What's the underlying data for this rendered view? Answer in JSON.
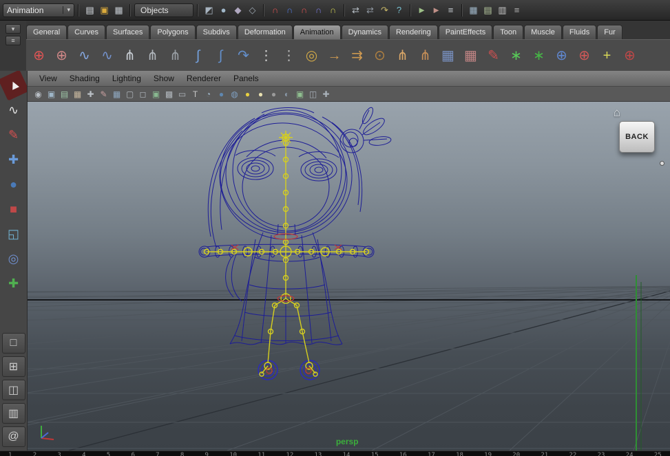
{
  "statusbar": {
    "mode": "Animation",
    "dropdown_arrow": "▾",
    "objects_label": "Objects",
    "file_icons": [
      {
        "name": "new-scene-icon",
        "glyph": "▤",
        "color": "#dde2e8"
      },
      {
        "name": "open-scene-icon",
        "glyph": "▣",
        "color": "#dcab3c"
      },
      {
        "name": "save-scene-icon",
        "glyph": "▦",
        "color": "#c4cad0"
      }
    ],
    "mask_icons": [
      {
        "name": "select-by-hierarchy-icon",
        "glyph": "◩",
        "color": "#a8b4c0"
      },
      {
        "name": "select-by-object-icon",
        "glyph": "●",
        "color": "#9fb6c8"
      },
      {
        "name": "select-by-component-icon",
        "glyph": "◆",
        "color": "#b0a8c0"
      },
      {
        "name": "selection-lock-icon",
        "glyph": "◇",
        "color": "#9aa4ae"
      }
    ],
    "snap_icons": [
      {
        "name": "snap-to-grid-icon",
        "glyph": "∩",
        "color": "#d85050"
      },
      {
        "name": "snap-to-curve-icon",
        "glyph": "∩",
        "color": "#5078d8"
      },
      {
        "name": "snap-to-point-icon",
        "glyph": "∩",
        "color": "#d85050"
      },
      {
        "name": "snap-to-plane-icon",
        "glyph": "∩",
        "color": "#7878d8"
      },
      {
        "name": "snap-to-view-icon",
        "glyph": "∩",
        "color": "#c8c850"
      }
    ],
    "history_icons": [
      {
        "name": "input-connections-icon",
        "glyph": "⇄",
        "color": "#b8c0c8"
      },
      {
        "name": "output-connections-icon",
        "glyph": "⇄",
        "color": "#8e96a0"
      },
      {
        "name": "construction-history-icon",
        "glyph": "↷",
        "color": "#c8b868"
      },
      {
        "name": "help-icon",
        "glyph": "?",
        "color": "#78c0d0"
      }
    ],
    "render_icons": [
      {
        "name": "render-current-frame-icon",
        "glyph": "►",
        "color": "#9ec088"
      },
      {
        "name": "ipr-render-icon",
        "glyph": "►",
        "color": "#c09088"
      },
      {
        "name": "render-settings-icon",
        "glyph": "≡",
        "color": "#c4cad0"
      }
    ],
    "panel_shortcut_icons": [
      {
        "name": "hypershade-panel-icon",
        "glyph": "▦",
        "color": "#9fb6c8"
      },
      {
        "name": "hypergraph-panel-icon",
        "glyph": "▤",
        "color": "#b6c89f"
      },
      {
        "name": "attribute-editor-icon",
        "glyph": "▥",
        "color": "#c8c8c8"
      },
      {
        "name": "tool-settings-icon",
        "glyph": "≡",
        "color": "#b0b0b0"
      }
    ]
  },
  "shelf": {
    "side_buttons": [
      {
        "name": "shelf-tabs-menu-icon",
        "glyph": "▾"
      },
      {
        "name": "shelf-menu-icon",
        "glyph": "≡"
      }
    ],
    "tabs": [
      {
        "name": "shelf-tab-general",
        "label": "General"
      },
      {
        "name": "shelf-tab-curves",
        "label": "Curves"
      },
      {
        "name": "shelf-tab-surfaces",
        "label": "Surfaces"
      },
      {
        "name": "shelf-tab-polygons",
        "label": "Polygons"
      },
      {
        "name": "shelf-tab-subdivs",
        "label": "Subdivs"
      },
      {
        "name": "shelf-tab-deformation",
        "label": "Deformation"
      },
      {
        "name": "shelf-tab-animation",
        "label": "Animation",
        "active": true
      },
      {
        "name": "shelf-tab-dynamics",
        "label": "Dynamics"
      },
      {
        "name": "shelf-tab-rendering",
        "label": "Rendering"
      },
      {
        "name": "shelf-tab-painteffects",
        "label": "PaintEffects"
      },
      {
        "name": "shelf-tab-toon",
        "label": "Toon"
      },
      {
        "name": "shelf-tab-muscle",
        "label": "Muscle"
      },
      {
        "name": "shelf-tab-fluids",
        "label": "Fluids"
      },
      {
        "name": "shelf-tab-fur",
        "label": "Fur"
      }
    ],
    "icons": [
      {
        "name": "set-key-icon",
        "glyph": "⊕",
        "color": "#e05555"
      },
      {
        "name": "set-breakdown-icon",
        "glyph": "⊕",
        "color": "#d08888"
      },
      {
        "name": "anim-curve-icon",
        "glyph": "∿",
        "color": "#86a8e0"
      },
      {
        "name": "anim-snapshot-icon",
        "glyph": "∿",
        "color": "#7492cc"
      },
      {
        "name": "skeleton-icon",
        "glyph": "⋔",
        "color": "#c8ced4"
      },
      {
        "name": "pose-icon",
        "glyph": "⋔",
        "color": "#b2b8be"
      },
      {
        "name": "walk-cycle-icon",
        "glyph": "⋔",
        "color": "#9aa0a6"
      },
      {
        "name": "joint-tool-icon",
        "glyph": "∫",
        "color": "#74a0dc"
      },
      {
        "name": "ik-handle-icon",
        "glyph": "∫",
        "color": "#6490cc"
      },
      {
        "name": "ik-spline-icon",
        "glyph": "↷",
        "color": "#6490cc"
      },
      {
        "name": "cluster-icon",
        "glyph": "⋮",
        "color": "#d0d0d0"
      },
      {
        "name": "lattice-points-icon",
        "glyph": "⋮",
        "color": "#b4b4b4"
      },
      {
        "name": "locator-icon",
        "glyph": "◎",
        "color": "#d0a848"
      },
      {
        "name": "point-constraint-icon",
        "glyph": "→",
        "color": "#cc9850"
      },
      {
        "name": "aim-constraint-icon",
        "glyph": "⇉",
        "color": "#cc9850"
      },
      {
        "name": "orient-constraint-icon",
        "glyph": "⊙",
        "color": "#b08040"
      },
      {
        "name": "character-set-icon",
        "glyph": "⋔",
        "color": "#dca868"
      },
      {
        "name": "subcharacter-icon",
        "glyph": "⋔",
        "color": "#c89058"
      },
      {
        "name": "anim-clip-icon",
        "glyph": "▦",
        "color": "#7890c0"
      },
      {
        "name": "anim-clip-2-icon",
        "glyph": "▦",
        "color": "#c08484"
      },
      {
        "name": "paint-skin-weights-icon",
        "glyph": "✎",
        "color": "#cc5050"
      },
      {
        "name": "motion-trail-icon",
        "glyph": "∗",
        "color": "#58c858"
      },
      {
        "name": "ghosting-icon",
        "glyph": "∗",
        "color": "#46b446"
      },
      {
        "name": "ik-fk-blend-icon",
        "glyph": "⊕",
        "color": "#6088d0"
      },
      {
        "name": "pole-vector-icon",
        "glyph": "⊕",
        "color": "#d05858"
      },
      {
        "name": "pin-joint-icon",
        "glyph": "+",
        "color": "#d8d858"
      },
      {
        "name": "rig-control-icon",
        "glyph": "⊕",
        "color": "#c04848"
      }
    ]
  },
  "toolbox": {
    "tools": [
      {
        "name": "select-tool",
        "glyph": "►",
        "color": "#f0f0f0",
        "bg": "#5f2020",
        "rot": -115
      },
      {
        "name": "lasso-tool",
        "glyph": "∿",
        "color": "#e0e0e0"
      },
      {
        "name": "paint-selection-tool",
        "glyph": "✎",
        "color": "#d85050"
      },
      {
        "name": "move-tool",
        "glyph": "✚",
        "color": "#6a9ad8"
      },
      {
        "name": "rotate-tool",
        "glyph": "●",
        "color": "#4a7ab8"
      },
      {
        "name": "scale-tool",
        "glyph": "■",
        "color": "#c04848"
      },
      {
        "name": "universal-manipulator-tool",
        "glyph": "◱",
        "color": "#70b0d0"
      },
      {
        "name": "soft-modification-tool",
        "glyph": "◎",
        "color": "#7090d0"
      },
      {
        "name": "show-manipulator-tool",
        "glyph": "✚",
        "color": "#50b050"
      }
    ],
    "layouts": [
      {
        "name": "layout-single-pane",
        "glyph": "□"
      },
      {
        "name": "layout-four-pane",
        "glyph": "⊞"
      },
      {
        "name": "layout-persp-outliner",
        "glyph": "◫"
      },
      {
        "name": "layout-persp-graph",
        "glyph": "▥"
      },
      {
        "name": "layout-hypergraph",
        "glyph": "@"
      }
    ]
  },
  "panel": {
    "menus": [
      {
        "name": "panel-menu-view",
        "label": "View"
      },
      {
        "name": "panel-menu-shading",
        "label": "Shading"
      },
      {
        "name": "panel-menu-lighting",
        "label": "Lighting"
      },
      {
        "name": "panel-menu-show",
        "label": "Show"
      },
      {
        "name": "panel-menu-renderer",
        "label": "Renderer"
      },
      {
        "name": "panel-menu-panels",
        "label": "Panels"
      }
    ],
    "toolbar_icons": [
      {
        "name": "select-camera-icon",
        "glyph": "◉",
        "color": "#b8bec4"
      },
      {
        "name": "camera-attributes-icon",
        "glyph": "▣",
        "color": "#9fb6c8"
      },
      {
        "name": "bookmarks-icon",
        "glyph": "▤",
        "color": "#9fc8a8"
      },
      {
        "name": "image-plane-icon",
        "glyph": "▦",
        "color": "#c8b89f"
      },
      {
        "name": "2d-pan-zoom-icon",
        "glyph": "✚",
        "color": "#b8bec4"
      },
      {
        "name": "grease-pencil-icon",
        "glyph": "✎",
        "color": "#c8a0a0"
      },
      {
        "name": "grid-toggle-icon",
        "glyph": "▦",
        "color": "#8fa8c0"
      },
      {
        "name": "film-gate-icon",
        "glyph": "▢",
        "color": "#b0b6bc"
      },
      {
        "name": "resolution-gate-icon",
        "glyph": "◻",
        "color": "#b0b6bc"
      },
      {
        "name": "gate-mask-icon",
        "glyph": "▣",
        "color": "#88b890"
      },
      {
        "name": "field-chart-icon",
        "glyph": "▩",
        "color": "#b0b6bc"
      },
      {
        "name": "safe-action-icon",
        "glyph": "▭",
        "color": "#b0b6bc"
      },
      {
        "name": "safe-title-icon",
        "glyph": "T",
        "color": "#c8c8c8"
      },
      {
        "name": "wireframe-mode-icon",
        "glyph": "◔",
        "color": "#9fb6c8"
      },
      {
        "name": "shaded-mode-icon",
        "glyph": "●",
        "color": "#5f87b0"
      },
      {
        "name": "textured-mode-icon",
        "glyph": "◍",
        "color": "#7f9fc0"
      },
      {
        "name": "all-lights-icon",
        "glyph": "●",
        "color": "#e8d040"
      },
      {
        "name": "default-light-icon",
        "glyph": "●",
        "color": "#e8e0b0"
      },
      {
        "name": "no-lights-icon",
        "glyph": "●",
        "color": "#9a9a9a"
      },
      {
        "name": "shadows-icon",
        "glyph": "◐",
        "color": "#8a9aaa"
      },
      {
        "name": "isolate-select-icon",
        "glyph": "▣",
        "color": "#90c090"
      },
      {
        "name": "xray-icon",
        "glyph": "◫",
        "color": "#a8b0b8"
      },
      {
        "name": "xray-joints-icon",
        "glyph": "✚",
        "color": "#a8b0b8"
      }
    ]
  },
  "viewport": {
    "camera_label": "persp",
    "back_label": "BACK",
    "home_icon": "⌂",
    "colors": {
      "wire": "#1d1d96",
      "wire-bright": "#2a2ac0",
      "skeleton": "#d6cf1f",
      "accent-red": "#c23737",
      "grid": "#4e555c",
      "grid-major": "#15171a",
      "axis-green": "#2f8f34"
    }
  },
  "timeline": {
    "ticks": [
      {
        "name": "tick",
        "label": "1"
      },
      {
        "name": "tick",
        "label": "2"
      },
      {
        "name": "tick",
        "label": "3"
      },
      {
        "name": "tick",
        "label": "4"
      },
      {
        "name": "tick",
        "label": "5"
      },
      {
        "name": "tick",
        "label": "6"
      },
      {
        "name": "tick",
        "label": "7"
      },
      {
        "name": "tick",
        "label": "8"
      },
      {
        "name": "tick",
        "label": "9"
      },
      {
        "name": "tick",
        "label": "10"
      },
      {
        "name": "tick",
        "label": "11"
      },
      {
        "name": "tick",
        "label": "12"
      },
      {
        "name": "tick",
        "label": "13"
      },
      {
        "name": "tick",
        "label": "14"
      },
      {
        "name": "tick",
        "label": "15"
      },
      {
        "name": "tick",
        "label": "16"
      },
      {
        "name": "tick",
        "label": "17"
      },
      {
        "name": "tick",
        "label": "18"
      },
      {
        "name": "tick",
        "label": "19"
      },
      {
        "name": "tick",
        "label": "20"
      },
      {
        "name": "tick",
        "label": "21"
      },
      {
        "name": "tick",
        "label": "22"
      },
      {
        "name": "tick",
        "label": "23"
      },
      {
        "name": "tick",
        "label": "24"
      },
      {
        "name": "tick",
        "label": "25"
      }
    ]
  }
}
